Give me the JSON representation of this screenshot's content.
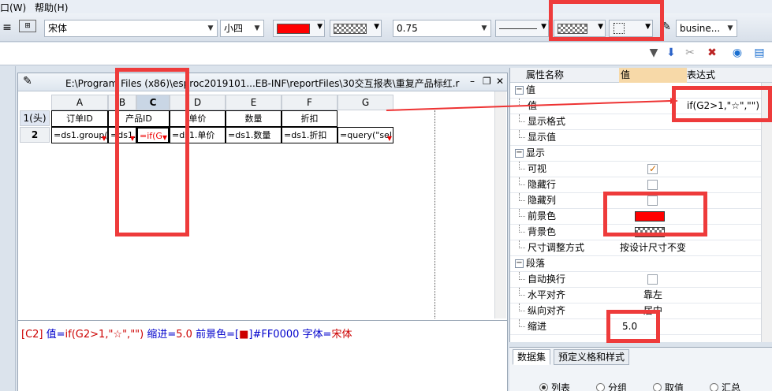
{
  "menu": {
    "window": "口(W)",
    "help": "帮助(H)"
  },
  "toolbar": {
    "font": "宋体",
    "font_size": "小四",
    "line_width": "0.75",
    "style_combo": "busine...",
    "fore_color": "#FF0000"
  },
  "designer": {
    "title": "E:\\Program Files (x86)\\esproc2019101...EB-INF\\reportFiles\\30交互报表\\重复产品标红.rpx",
    "columns": [
      "A",
      "B",
      "C",
      "D",
      "E",
      "F",
      "G"
    ],
    "row_labels": [
      "1(头)",
      "2"
    ],
    "header_cells": [
      "订单ID",
      "产品ID",
      "单价",
      "数量",
      "折扣"
    ],
    "data_cells": [
      "=ds1.group(",
      "=ds1.",
      "=if(G",
      "=ds1.单价",
      "=ds1.数量",
      "=ds1.折扣",
      "=query(\"sel"
    ],
    "status": {
      "cell": "[C2]",
      "value_label": "值=",
      "value": "if(G2>1,\"☆\",\"\")",
      "indent_label": "缩进=",
      "indent": "5.0",
      "fg_label": "前景色=[",
      "fg_sw": "■",
      "fg_close": "]",
      "fg_hex": "#FF0000",
      "font_label": "字体=",
      "font": "宋体"
    }
  },
  "props": {
    "headers": {
      "name": "属性名称",
      "value": "值",
      "expr": "表达式"
    },
    "rows": [
      {
        "type": "group",
        "name": "值"
      },
      {
        "type": "item",
        "name": "值",
        "value": "",
        "expr": "if(G2>1,\"☆\",\"\")"
      },
      {
        "type": "item",
        "name": "显示格式",
        "value": "",
        "expr": ""
      },
      {
        "type": "item",
        "name": "显示值",
        "value": "",
        "expr": ""
      },
      {
        "type": "group",
        "name": "显示"
      },
      {
        "type": "check",
        "name": "可视",
        "checked": true
      },
      {
        "type": "check",
        "name": "隐藏行",
        "checked": false
      },
      {
        "type": "check",
        "name": "隐藏列",
        "checked": false
      },
      {
        "type": "color",
        "name": "前景色"
      },
      {
        "type": "pattern",
        "name": "背景色"
      },
      {
        "type": "item",
        "name": "尺寸调整方式",
        "value": "按设计尺寸不变",
        "expr": ""
      },
      {
        "type": "group",
        "name": "段落"
      },
      {
        "type": "check",
        "name": "自动换行",
        "checked": false
      },
      {
        "type": "item",
        "name": "水平对齐",
        "value": "靠左",
        "expr": ""
      },
      {
        "type": "item",
        "name": "纵向对齐",
        "value": "居中",
        "expr": ""
      },
      {
        "type": "item",
        "name": "缩进",
        "value": "5.0",
        "expr": ""
      }
    ]
  },
  "bottom": {
    "tabs": [
      "数据集",
      "预定义格和样式"
    ],
    "radios": [
      "列表",
      "分组",
      "取值",
      "汇总"
    ]
  }
}
